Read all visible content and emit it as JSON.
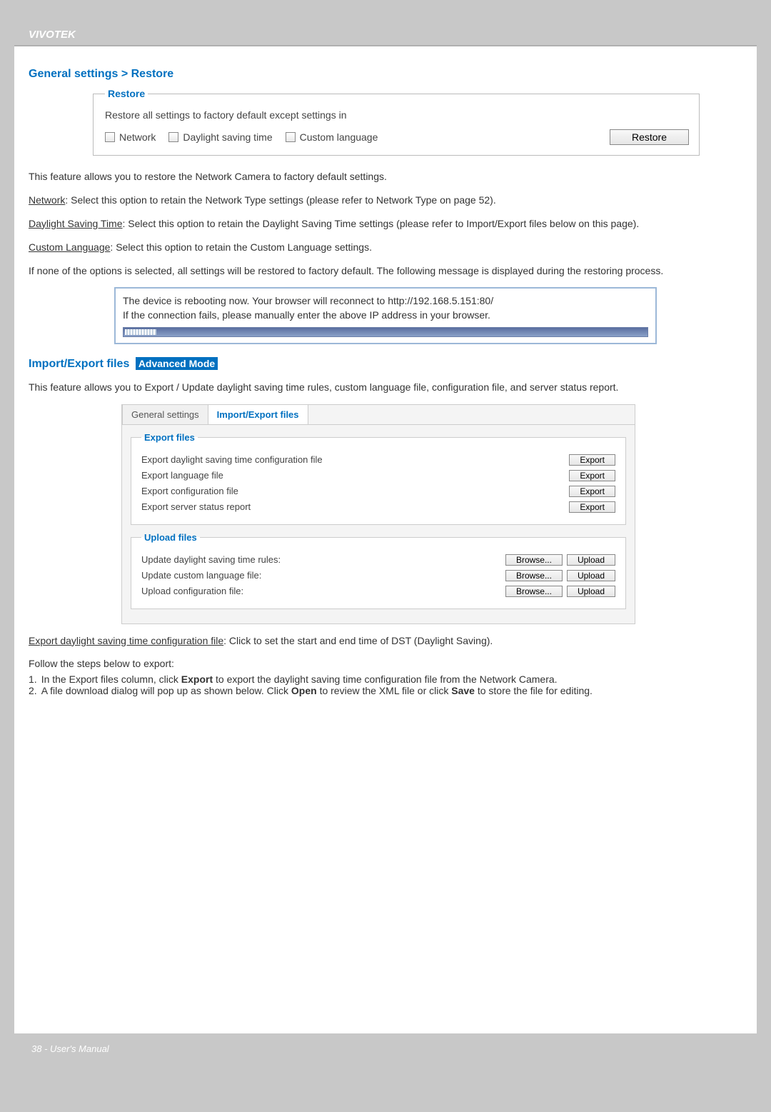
{
  "brand": "VIVOTEK",
  "section1": {
    "title": "General settings > Restore",
    "legend": "Restore",
    "desc": "Restore all settings to factory default except settings in",
    "chk_network": "Network",
    "chk_dst": "Daylight saving time",
    "chk_lang": "Custom language",
    "btn": "Restore"
  },
  "para_intro": "This feature allows you to restore the Network Camera to factory default settings.",
  "para_network_label": "Network",
  "para_network_text": ": Select this option to retain the Network Type settings (please refer to Network Type on page 52).",
  "para_dst_label": "Daylight Saving Time",
  "para_dst_text": ": Select this option to retain the Daylight Saving Time settings (please refer to Import/Export files below on this page).",
  "para_lang_label": "Custom Language",
  "para_lang_text": ": Select this option to retain the Custom Language settings.",
  "para_none": "If none of the options is selected, all settings will be restored to factory default.  The following message is displayed during the restoring process.",
  "reboot_line1": "The device is rebooting now. Your browser will reconnect to http://192.168.5.151:80/",
  "reboot_line2": "If the connection fails, please manually enter the above IP address in your browser.",
  "section2": {
    "title": "Import/Export files",
    "adv": "Advanced Mode",
    "intro": "This feature allows you to Export / Update daylight saving time rules, custom language file, configuration file, and server status report."
  },
  "tabs": {
    "t1": "General settings",
    "t2": "Import/Export files"
  },
  "export_fs": {
    "legend": "Export files",
    "r1": "Export daylight saving time configuration file",
    "r2": "Export language file",
    "r3": "Export configuration file",
    "r4": "Export server status report",
    "btn": "Export"
  },
  "upload_fs": {
    "legend": "Upload files",
    "r1": "Update daylight saving time rules:",
    "r2": "Update custom language file:",
    "r3": "Upload configuration file:",
    "browse": "Browse...",
    "upload": "Upload"
  },
  "para_export_label": "Export daylight saving time configuration file",
  "para_export_text": ": Click to set the start and end time of DST (Daylight Saving).",
  "follow": "Follow the steps below to export:",
  "step1_pre": "1.",
  "step1_a": "In the Export files column, click ",
  "step1_bold": "Export",
  "step1_b": " to export the daylight saving time configuration file from the Network Camera.",
  "step2_pre": "2.",
  "step2_a": "A file download dialog will pop up as shown below. Click ",
  "step2_bold1": "Open",
  "step2_b": " to review the XML file or click ",
  "step2_bold2": "Save",
  "step2_c": " to store the file for editing.",
  "footer": "38 - User's Manual"
}
